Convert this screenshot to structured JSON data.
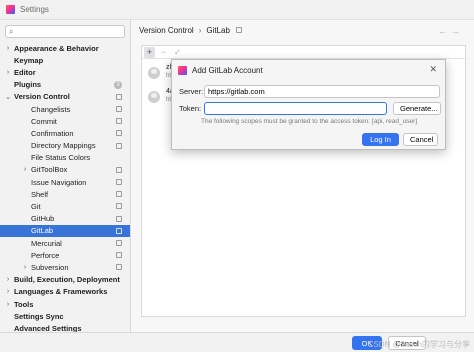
{
  "window": {
    "title": "Settings"
  },
  "sidebar": {
    "search": {
      "value": "",
      "placeholder": "",
      "icon": "search-icon"
    },
    "items": [
      {
        "label": "Appearance & Behavior",
        "level": 0,
        "bold": true,
        "arrow": "›"
      },
      {
        "label": "Keymap",
        "level": 0,
        "bold": true,
        "arrow": ""
      },
      {
        "label": "Editor",
        "level": 0,
        "bold": true,
        "arrow": "›"
      },
      {
        "label": "Plugins",
        "level": 0,
        "bold": true,
        "arrow": "",
        "badge": "3"
      },
      {
        "label": "Version Control",
        "level": 0,
        "bold": true,
        "arrow": "⌄",
        "cfg": true
      },
      {
        "label": "Changelists",
        "level": 1,
        "cfg": true
      },
      {
        "label": "Commit",
        "level": 1,
        "cfg": true
      },
      {
        "label": "Confirmation",
        "level": 1,
        "cfg": true
      },
      {
        "label": "Directory Mappings",
        "level": 1,
        "cfg": true
      },
      {
        "label": "File Status Colors",
        "level": 1
      },
      {
        "label": "GitToolBox",
        "level": 1,
        "cfg": true,
        "arrow": "›"
      },
      {
        "label": "Issue Navigation",
        "level": 1,
        "cfg": true
      },
      {
        "label": "Shelf",
        "level": 1,
        "cfg": true
      },
      {
        "label": "Git",
        "level": 1,
        "cfg": true
      },
      {
        "label": "GitHub",
        "level": 1,
        "cfg": true
      },
      {
        "label": "GitLab",
        "level": 1,
        "cfg": true,
        "selected": true
      },
      {
        "label": "Mercurial",
        "level": 1,
        "cfg": true
      },
      {
        "label": "Perforce",
        "level": 1,
        "cfg": true
      },
      {
        "label": "Subversion",
        "level": 1,
        "cfg": true,
        "arrow": "›"
      },
      {
        "label": "Build, Execution, Deployment",
        "level": 0,
        "bold": true,
        "arrow": "›"
      },
      {
        "label": "Languages & Frameworks",
        "level": 0,
        "bold": true,
        "arrow": "›"
      },
      {
        "label": "Tools",
        "level": 0,
        "bold": true,
        "arrow": "›"
      },
      {
        "label": "Settings Sync",
        "level": 0,
        "bold": true,
        "arrow": ""
      },
      {
        "label": "Advanced Settings",
        "level": 0,
        "bold": true,
        "arrow": ""
      }
    ]
  },
  "main": {
    "breadcrumb": {
      "parent": "Version Control",
      "separator": "›",
      "current": "GitLab"
    },
    "nav": {
      "back": "←",
      "forward": "→"
    },
    "toolbar": {
      "add": "+",
      "remove": "−",
      "check": "✓"
    },
    "accounts": [
      {
        "name": "zh",
        "server": "ht"
      },
      {
        "name": "4a",
        "server": "ht"
      }
    ]
  },
  "dialog": {
    "title": "Add GitLab Account",
    "close": "✕",
    "server_label": "Server:",
    "server_value": "https://gitlab.com",
    "token_label": "Token:",
    "token_value": "",
    "generate_label": "Generate...",
    "hint": "The following scopes must be granted to the access token: [api, read_user]",
    "login_label": "Log In",
    "cancel_label": "Cancel"
  },
  "footer": {
    "ok_label": "OK",
    "cancel_label": "Cancel",
    "watermark": "CSDN @Jason的学习与分享"
  },
  "colors": {
    "accent": "#3574f0",
    "selected": "#3874d8"
  }
}
